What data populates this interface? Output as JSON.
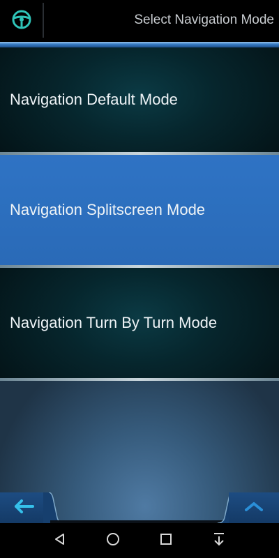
{
  "header": {
    "title": "Select Navigation Mode",
    "icon": "steering-wheel-icon",
    "accent_color": "#3a7fc8"
  },
  "modes": [
    {
      "label": "Navigation Default Mode",
      "selected": false
    },
    {
      "label": "Navigation Splitscreen Mode",
      "selected": true
    },
    {
      "label": "Navigation Turn By Turn Mode",
      "selected": false
    }
  ],
  "colors": {
    "selected_row": "#2c6fbe",
    "dark_row": "#06262d",
    "icon_teal": "#2fc4b8",
    "icon_blue": "#2a8fd8"
  },
  "bottom_bar": {
    "back_icon": "arrow-left-icon",
    "up_icon": "chevron-up-icon"
  },
  "system_nav": {
    "back_icon": "triangle-back-icon",
    "home_icon": "circle-home-icon",
    "recents_icon": "square-recents-icon",
    "extra_icon": "arrow-down-bar-icon"
  }
}
